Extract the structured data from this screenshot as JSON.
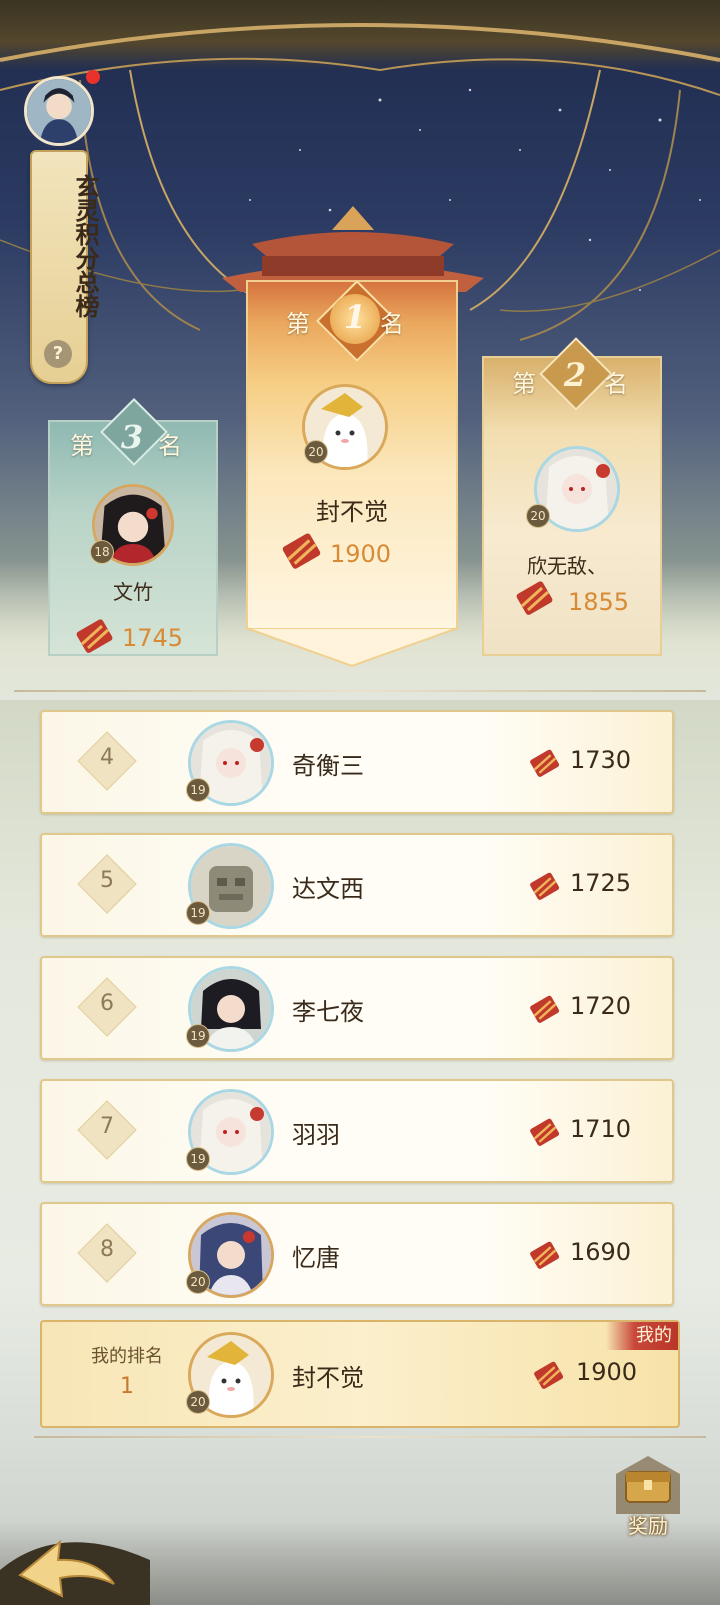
{
  "title": "玄灵积分总榜",
  "help_icon": "?",
  "colors": {
    "accent_gold": "#d88a35",
    "rank1_banner": "#f4c873",
    "rank2_banner": "#eddcab",
    "rank3_banner": "#a6c9c2",
    "my_tag_red": "#c8463a"
  },
  "podium": {
    "rank_prefix": "第",
    "rank_suffix": "名",
    "first": {
      "rank": "1",
      "level": "20",
      "name": "封不觉",
      "score": "1900",
      "avatar_icon": "white-ghost-avatar"
    },
    "second": {
      "rank": "2",
      "level": "20",
      "name": "欣无敌、",
      "score": "1855",
      "avatar_icon": "white-hair-lady-avatar"
    },
    "third": {
      "rank": "3",
      "level": "18",
      "name": "文竹",
      "score": "1745",
      "avatar_icon": "red-robe-lady-avatar"
    }
  },
  "list": [
    {
      "rank": "4",
      "level": "19",
      "name": "奇衡三",
      "score": "1730",
      "avatar_icon": "white-hair-lady-avatar"
    },
    {
      "rank": "5",
      "level": "19",
      "name": "达文西",
      "score": "1725",
      "avatar_icon": "stone-golem-avatar"
    },
    {
      "rank": "6",
      "level": "19",
      "name": "李七夜",
      "score": "1720",
      "avatar_icon": "dark-hair-man-avatar"
    },
    {
      "rank": "7",
      "level": "19",
      "name": "羽羽",
      "score": "1710",
      "avatar_icon": "white-hair-lady-avatar"
    },
    {
      "rank": "8",
      "level": "20",
      "name": "忆唐",
      "score": "1690",
      "avatar_icon": "blue-hair-man-avatar"
    }
  ],
  "my_rank": {
    "label": "我的排名",
    "rank": "1",
    "level": "20",
    "name": "封不觉",
    "score": "1900",
    "tag": "我的",
    "avatar_icon": "white-ghost-avatar"
  },
  "reward_button": {
    "label": "奖励",
    "icon": "treasure-chest-icon"
  },
  "back_button": {
    "icon": "back-arrow-icon"
  }
}
